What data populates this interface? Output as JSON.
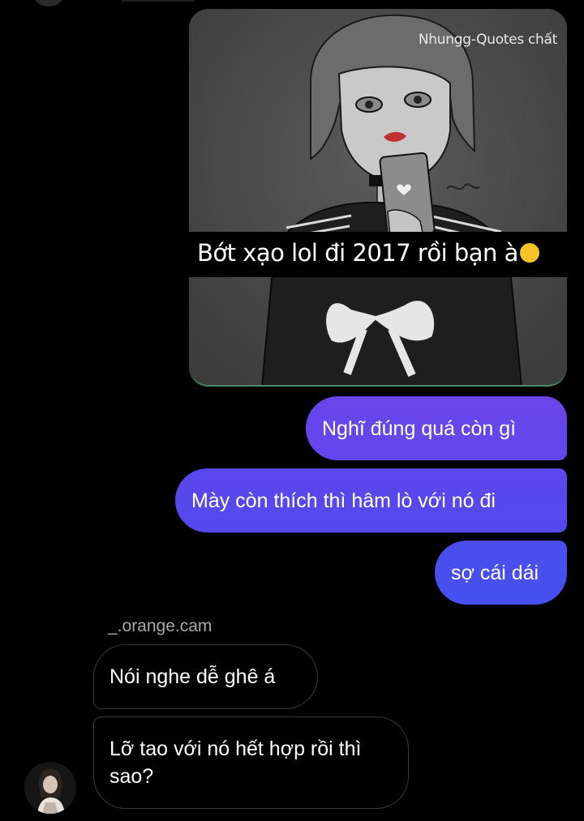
{
  "thread": {
    "shared_image": {
      "watermark": "Nhungg-Quotes chất",
      "caption": "Bớt xạo lol đi 2017 rồi bạn à"
    },
    "outgoing_messages": [
      "Nghĩ đúng quá còn gì",
      "Mày còn thích thì hâm lò với nó đi",
      "sợ cái dái"
    ],
    "sender_name": "_.orange.cam",
    "incoming_messages": [
      "Nói nghe dễ ghê á",
      "Lỡ tao với nó hết hợp rồi thì sao?"
    ]
  },
  "colors": {
    "background": "#000000",
    "outgoing_bubble_top": "#6a45ea",
    "outgoing_bubble_bottom": "#4650ef",
    "incoming_bubble_border": "#3a3a3a",
    "sender_label": "#a8a8a8"
  },
  "icons": {
    "caption_emoji": "smirking-face-emoji"
  }
}
